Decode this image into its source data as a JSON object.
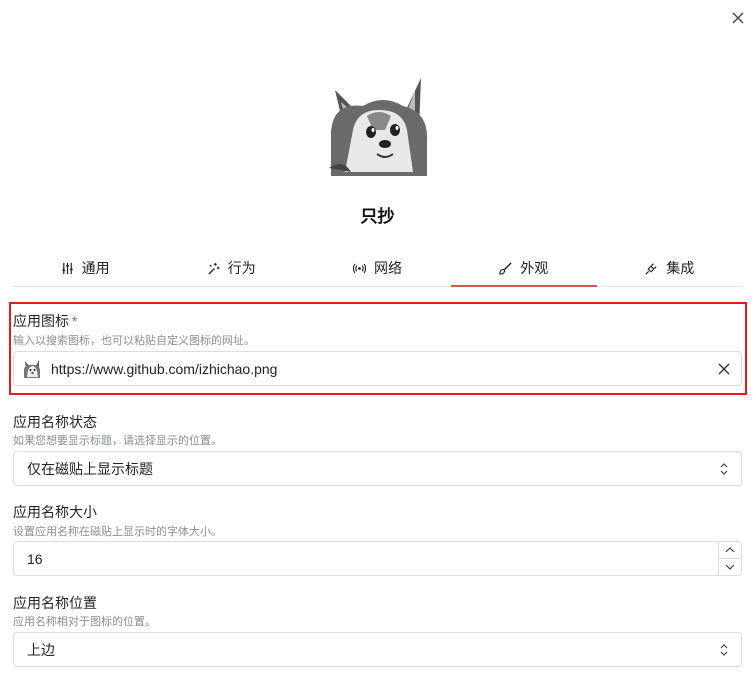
{
  "app": {
    "title": "只抄"
  },
  "tabs": [
    {
      "label": "通用",
      "icon": "sliders-icon"
    },
    {
      "label": "行为",
      "icon": "sparkle-wand-icon"
    },
    {
      "label": "网络",
      "icon": "broadcast-icon"
    },
    {
      "label": "外观",
      "icon": "brush-icon",
      "active": true
    },
    {
      "label": "集成",
      "icon": "plug-icon"
    }
  ],
  "fields": {
    "icon": {
      "label": "应用图标",
      "required_mark": "*",
      "desc": "输入以搜索图标，也可以粘贴自定义图标的网址。",
      "value": "https://www.github.com/izhichao.png"
    },
    "name_state": {
      "label": "应用名称状态",
      "desc": "如果您想要显示标题，请选择显示的位置。",
      "value": "仅在磁贴上显示标题"
    },
    "name_size": {
      "label": "应用名称大小",
      "desc": "设置应用名称在磁贴上显示时的字体大小。",
      "value": "16"
    },
    "name_position": {
      "label": "应用名称位置",
      "desc": "应用名称相对于图标的位置。",
      "value": "上边"
    }
  },
  "colors": {
    "accent": "#e05252",
    "highlight": "#e31b1b"
  }
}
